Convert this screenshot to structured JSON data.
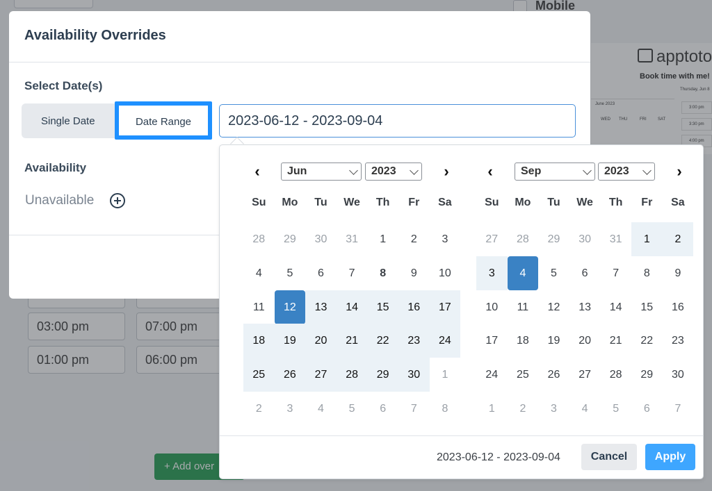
{
  "background": {
    "mobile_label": "Mobile",
    "times_row1": [
      "03:00 pm",
      "07:00 pm"
    ],
    "times_row2": [
      "01:00 pm",
      "06:00 pm"
    ],
    "add_override_label": "+ Add over",
    "preview": {
      "logo": "apptoto",
      "book_text": "Book time with me!",
      "date_text": "Thursday, Jun 8",
      "month": "June 2023",
      "dow": [
        "WED",
        "THU",
        "FRI",
        "SAT"
      ],
      "slots": [
        "3:00 pm",
        "3:30 pm",
        "4:00 pm"
      ]
    }
  },
  "modal": {
    "title": "Availability Overrides",
    "select_label": "Select Date(s)",
    "single_date_label": "Single Date",
    "date_range_label": "Date Range",
    "date_input_value": "2023-06-12 - 2023-09-04",
    "availability_label": "Availability",
    "unavailable_label": "Unavailable"
  },
  "picker": {
    "dow": [
      "Su",
      "Mo",
      "Tu",
      "We",
      "Th",
      "Fr",
      "Sa"
    ],
    "left": {
      "month": "Jun",
      "year": "2023"
    },
    "right": {
      "month": "Sep",
      "year": "2023"
    },
    "range_text": "2023-06-12 - 2023-09-04",
    "cancel_label": "Cancel",
    "apply_label": "Apply",
    "left_days": [
      [
        "28",
        "29",
        "30",
        "31",
        "1",
        "2",
        "3"
      ],
      [
        "4",
        "5",
        "6",
        "7",
        "8",
        "9",
        "10"
      ],
      [
        "11",
        "12",
        "13",
        "14",
        "15",
        "16",
        "17"
      ],
      [
        "18",
        "19",
        "20",
        "21",
        "22",
        "23",
        "24"
      ],
      [
        "25",
        "26",
        "27",
        "28",
        "29",
        "30",
        "1"
      ],
      [
        "2",
        "3",
        "4",
        "5",
        "6",
        "7",
        "8"
      ]
    ],
    "right_days": [
      [
        "27",
        "28",
        "29",
        "30",
        "31",
        "1",
        "2"
      ],
      [
        "3",
        "4",
        "5",
        "6",
        "7",
        "8",
        "9"
      ],
      [
        "10",
        "11",
        "12",
        "13",
        "14",
        "15",
        "16"
      ],
      [
        "17",
        "18",
        "19",
        "20",
        "21",
        "22",
        "23"
      ],
      [
        "24",
        "25",
        "26",
        "27",
        "28",
        "29",
        "30"
      ],
      [
        "1",
        "2",
        "3",
        "4",
        "5",
        "6",
        "7"
      ]
    ]
  },
  "colors": {
    "accent": "#3a82c4",
    "range_bg": "#ebf2f7",
    "apply": "#3ea6ff",
    "highlight_border": "#1e90ff"
  }
}
